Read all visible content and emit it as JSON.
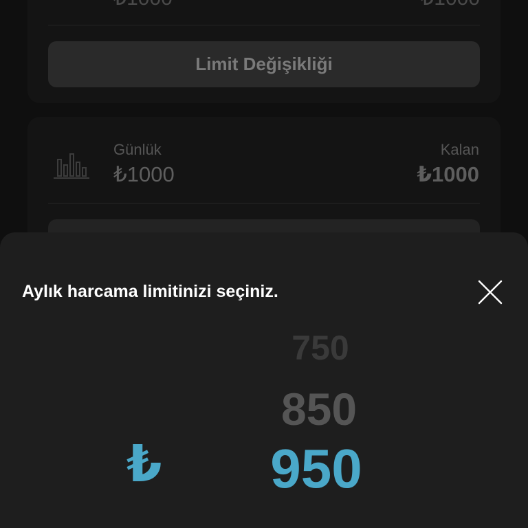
{
  "background": {
    "top_card": {
      "left_value": "₺1000",
      "right_value": "₺1000",
      "limit_button_label": "Limit Değişikliği"
    },
    "daily_card": {
      "label": "Günlük",
      "value": "₺1000",
      "remaining_label": "Kalan",
      "remaining_value": "₺1000",
      "icon": "bar-chart-icon"
    }
  },
  "sheet": {
    "title": "Aylık harcama limitinizi seçiniz.",
    "close_icon": "close-icon",
    "currency_symbol": "₺",
    "picker_options": [
      "750",
      "850",
      "950"
    ],
    "selected_value": "950",
    "accent_color": "#4aa8c9"
  }
}
